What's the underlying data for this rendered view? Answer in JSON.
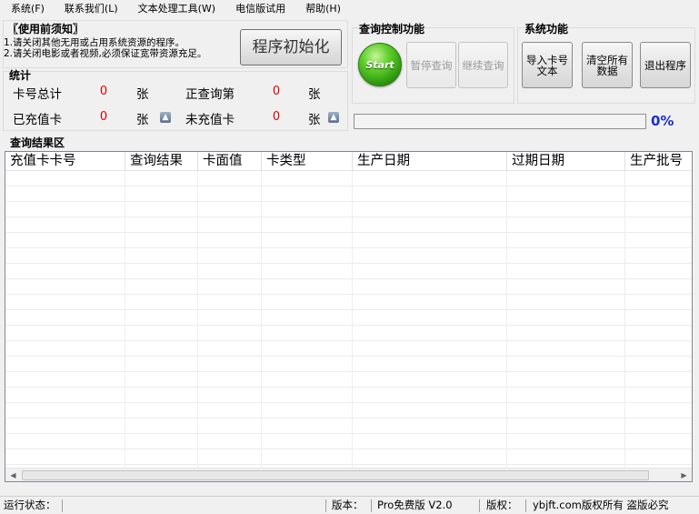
{
  "menu": [
    "系统(F)",
    "联系我们(L)",
    "文本处理工具(W)",
    "电信版试用",
    "帮助(H)"
  ],
  "notice": {
    "title": "〖使用前须知〗",
    "line1": "1.请关闭其他无用或占用系统资源的程序。",
    "line2": "2.请关闭电影或者视频,必须保证宽带资源充足。",
    "init_button": "程序初始化"
  },
  "stats": {
    "title": "统计",
    "total_label": "卡号总计",
    "total_value": "0",
    "querying_label": "正查询第",
    "querying_value": "0",
    "recharged_label": "已充值卡",
    "recharged_value": "0",
    "unrecharged_label": "未充值卡",
    "unrecharged_value": "0",
    "unit": "张"
  },
  "query_control": {
    "title": "查询控制功能",
    "start_label": "Start",
    "pause_label": "暂停查询",
    "resume_label": "继续查询"
  },
  "system": {
    "title": "系统功能",
    "import_label": "导入卡号\n文本",
    "clear_label": "清空所有\n数据",
    "exit_label": "退出程序"
  },
  "progress": {
    "percent": 0,
    "text": "0%"
  },
  "results": {
    "title": "查询结果区",
    "columns": [
      "充值卡卡号",
      "查询结果",
      "卡面值",
      "卡类型",
      "生产日期",
      "过期日期",
      "生产批号"
    ]
  },
  "status": {
    "run_label": "运行状态：",
    "run_value": "",
    "version_label": "版本：",
    "version_value": "Pro免费版 V2.0",
    "copyright_label": "版权：",
    "copyright_value": "ybjft.com版权所有 盗版必究"
  },
  "colors": {
    "stat_value": "#e00000",
    "progress_text": "#1a2fd0",
    "start_green": "#3aa815"
  }
}
